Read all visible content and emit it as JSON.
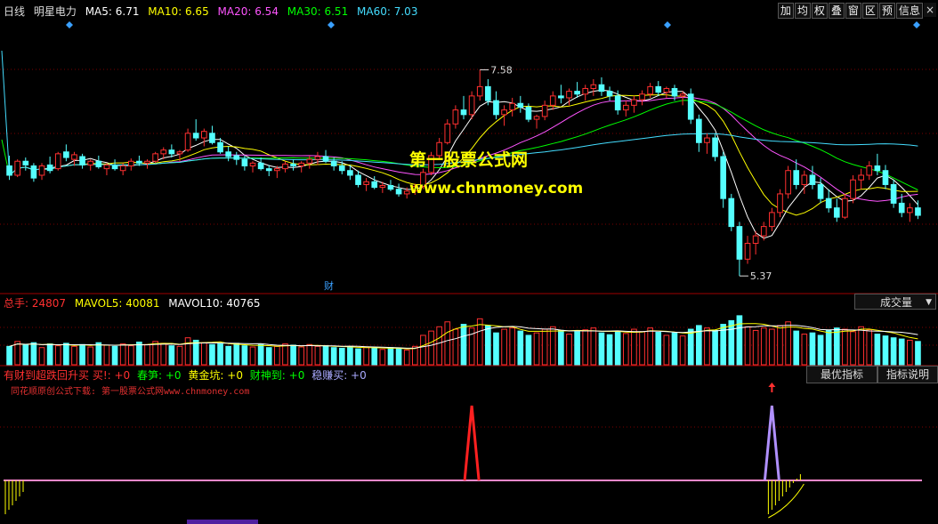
{
  "header": {
    "period": "日线",
    "stock_name": "明星电力",
    "ma": [
      {
        "label": "MA5: 6.71",
        "color": "#ffffff"
      },
      {
        "label": "MA10: 6.65",
        "color": "#ffff00"
      },
      {
        "label": "MA20: 6.54",
        "color": "#ff55ff"
      },
      {
        "label": "MA30: 6.51",
        "color": "#00ff00"
      },
      {
        "label": "MA60: 7.03",
        "color": "#44ddff"
      }
    ]
  },
  "toolbar": [
    "加",
    "均",
    "权",
    "叠",
    "窗",
    "区",
    "预",
    "信息"
  ],
  "toolbar_close": "×",
  "watermark": {
    "line1": "第一股票公式网",
    "line2": "www.chnmoney.com"
  },
  "price_labels": {
    "high": "7.58",
    "low": "5.37",
    "event": "财"
  },
  "volume": {
    "label_total": "总手: 24807",
    "label_mavol5": "MAVOL5: 40081",
    "label_mavol10": "MAVOL10: 40765",
    "dropdown": "成交量",
    "colors": {
      "total": "#ff3030",
      "mavol5": "#ffff00",
      "mavol10": "#ffffff"
    }
  },
  "indicator": {
    "items": [
      {
        "label": "有财到超跌回升买 买!: +0",
        "color": "#ff3030"
      },
      {
        "label": "春笋: +0",
        "color": "#00ff00"
      },
      {
        "label": "黄金坑: +0",
        "color": "#ffff00"
      },
      {
        "label": "财神到: +0",
        "color": "#00ff00"
      },
      {
        "label": "稳赚买: +0",
        "color": "#aaaaff"
      }
    ],
    "subtitle": "同花顺原创公式下载: 第一股票公式网www.chnmoney.com",
    "btn_best": "最优指标",
    "btn_desc": "指标说明"
  },
  "colors": {
    "up": "#ff3030",
    "down": "#55ffff",
    "bg": "#000000",
    "grid": "#a00000"
  },
  "chart_data": {
    "type": "candlestick",
    "price_range": [
      5.2,
      8.1
    ],
    "annotated_high": 7.58,
    "annotated_low": 5.37,
    "ohlc": [
      [
        6.55,
        6.66,
        6.4,
        6.45
      ],
      [
        6.45,
        6.62,
        6.43,
        6.6
      ],
      [
        6.6,
        6.64,
        6.5,
        6.56
      ],
      [
        6.55,
        6.58,
        6.38,
        6.42
      ],
      [
        6.45,
        6.58,
        6.4,
        6.55
      ],
      [
        6.56,
        6.65,
        6.47,
        6.5
      ],
      [
        6.52,
        6.7,
        6.5,
        6.68
      ],
      [
        6.7,
        6.78,
        6.6,
        6.64
      ],
      [
        6.62,
        6.7,
        6.55,
        6.67
      ],
      [
        6.65,
        6.68,
        6.52,
        6.56
      ],
      [
        6.56,
        6.62,
        6.5,
        6.6
      ],
      [
        6.6,
        6.66,
        6.52,
        6.54
      ],
      [
        6.52,
        6.58,
        6.45,
        6.56
      ],
      [
        6.55,
        6.62,
        6.5,
        6.52
      ],
      [
        6.5,
        6.58,
        6.45,
        6.55
      ],
      [
        6.55,
        6.63,
        6.5,
        6.6
      ],
      [
        6.6,
        6.66,
        6.55,
        6.58
      ],
      [
        6.58,
        6.62,
        6.52,
        6.6
      ],
      [
        6.6,
        6.7,
        6.58,
        6.68
      ],
      [
        6.68,
        6.75,
        6.62,
        6.72
      ],
      [
        6.72,
        6.78,
        6.64,
        6.68
      ],
      [
        6.68,
        6.72,
        6.6,
        6.7
      ],
      [
        6.72,
        6.95,
        6.7,
        6.9
      ],
      [
        6.9,
        7.05,
        6.82,
        6.85
      ],
      [
        6.85,
        6.95,
        6.76,
        6.92
      ],
      [
        6.9,
        6.98,
        6.78,
        6.8
      ],
      [
        6.8,
        6.85,
        6.68,
        6.7
      ],
      [
        6.7,
        6.76,
        6.6,
        6.65
      ],
      [
        6.66,
        6.7,
        6.56,
        6.62
      ],
      [
        6.62,
        6.66,
        6.5,
        6.55
      ],
      [
        6.55,
        6.6,
        6.48,
        6.58
      ],
      [
        6.58,
        6.64,
        6.5,
        6.52
      ],
      [
        6.52,
        6.56,
        6.44,
        6.5
      ],
      [
        6.5,
        6.55,
        6.42,
        6.52
      ],
      [
        6.52,
        6.6,
        6.48,
        6.57
      ],
      [
        6.57,
        6.62,
        6.5,
        6.55
      ],
      [
        6.55,
        6.6,
        6.48,
        6.58
      ],
      [
        6.58,
        6.66,
        6.52,
        6.62
      ],
      [
        6.62,
        6.7,
        6.56,
        6.65
      ],
      [
        6.65,
        6.72,
        6.58,
        6.6
      ],
      [
        6.6,
        6.64,
        6.5,
        6.55
      ],
      [
        6.55,
        6.6,
        6.46,
        6.5
      ],
      [
        6.5,
        6.56,
        6.4,
        6.45
      ],
      [
        6.45,
        6.5,
        6.32,
        6.35
      ],
      [
        6.35,
        6.42,
        6.28,
        6.38
      ],
      [
        6.38,
        6.44,
        6.3,
        6.32
      ],
      [
        6.32,
        6.38,
        6.26,
        6.34
      ],
      [
        6.34,
        6.4,
        6.28,
        6.3
      ],
      [
        6.3,
        6.36,
        6.22,
        6.25
      ],
      [
        6.25,
        6.32,
        6.2,
        6.28
      ],
      [
        6.28,
        6.36,
        6.24,
        6.33
      ],
      [
        6.33,
        6.52,
        6.3,
        6.48
      ],
      [
        6.48,
        6.7,
        6.45,
        6.66
      ],
      [
        6.66,
        6.85,
        6.62,
        6.8
      ],
      [
        6.8,
        7.05,
        6.78,
        7.0
      ],
      [
        7.0,
        7.2,
        6.95,
        7.15
      ],
      [
        7.15,
        7.3,
        7.05,
        7.1
      ],
      [
        7.1,
        7.35,
        7.05,
        7.3
      ],
      [
        7.3,
        7.58,
        7.25,
        7.4
      ],
      [
        7.4,
        7.48,
        7.2,
        7.25
      ],
      [
        7.25,
        7.35,
        7.05,
        7.1
      ],
      [
        7.1,
        7.2,
        6.98,
        7.15
      ],
      [
        7.15,
        7.28,
        7.08,
        7.22
      ],
      [
        7.22,
        7.3,
        7.12,
        7.18
      ],
      [
        7.18,
        7.22,
        7.02,
        7.05
      ],
      [
        7.05,
        7.1,
        6.95,
        7.08
      ],
      [
        7.08,
        7.25,
        7.04,
        7.2
      ],
      [
        7.2,
        7.35,
        7.15,
        7.3
      ],
      [
        7.3,
        7.42,
        7.22,
        7.28
      ],
      [
        7.28,
        7.38,
        7.2,
        7.35
      ],
      [
        7.35,
        7.45,
        7.28,
        7.32
      ],
      [
        7.32,
        7.42,
        7.25,
        7.38
      ],
      [
        7.38,
        7.48,
        7.3,
        7.42
      ],
      [
        7.42,
        7.5,
        7.3,
        7.35
      ],
      [
        7.35,
        7.4,
        7.25,
        7.3
      ],
      [
        7.3,
        7.36,
        7.1,
        7.15
      ],
      [
        7.15,
        7.25,
        7.08,
        7.2
      ],
      [
        7.2,
        7.3,
        7.12,
        7.26
      ],
      [
        7.26,
        7.36,
        7.2,
        7.32
      ],
      [
        7.32,
        7.44,
        7.28,
        7.4
      ],
      [
        7.4,
        7.46,
        7.3,
        7.34
      ],
      [
        7.34,
        7.4,
        7.28,
        7.38
      ],
      [
        7.38,
        7.42,
        7.25,
        7.3
      ],
      [
        7.3,
        7.35,
        7.2,
        7.32
      ],
      [
        7.32,
        7.38,
        7.0,
        7.05
      ],
      [
        7.05,
        7.1,
        6.7,
        6.8
      ],
      [
        6.8,
        6.9,
        6.68,
        6.85
      ],
      [
        6.85,
        6.9,
        6.6,
        6.65
      ],
      [
        6.65,
        6.7,
        6.1,
        6.2
      ],
      [
        6.2,
        6.25,
        5.85,
        5.9
      ],
      [
        5.9,
        5.95,
        5.37,
        5.55
      ],
      [
        5.55,
        5.8,
        5.5,
        5.72
      ],
      [
        5.72,
        5.85,
        5.6,
        5.8
      ],
      [
        5.8,
        5.95,
        5.75,
        5.9
      ],
      [
        5.9,
        6.1,
        5.85,
        6.05
      ],
      [
        6.05,
        6.3,
        6.0,
        6.25
      ],
      [
        6.25,
        6.55,
        6.2,
        6.5
      ],
      [
        6.5,
        6.62,
        6.3,
        6.35
      ],
      [
        6.35,
        6.5,
        6.25,
        6.45
      ],
      [
        6.45,
        6.55,
        6.3,
        6.35
      ],
      [
        6.35,
        6.42,
        6.15,
        6.2
      ],
      [
        6.2,
        6.3,
        6.05,
        6.1
      ],
      [
        6.1,
        6.2,
        5.95,
        6.0
      ],
      [
        6.0,
        6.25,
        5.98,
        6.2
      ],
      [
        6.2,
        6.45,
        6.15,
        6.4
      ],
      [
        6.4,
        6.52,
        6.3,
        6.45
      ],
      [
        6.45,
        6.6,
        6.4,
        6.55
      ],
      [
        6.55,
        6.68,
        6.45,
        6.5
      ],
      [
        6.5,
        6.56,
        6.3,
        6.35
      ],
      [
        6.35,
        6.4,
        6.1,
        6.15
      ],
      [
        6.15,
        6.25,
        6.0,
        6.05
      ],
      [
        6.05,
        6.15,
        5.95,
        6.1
      ],
      [
        6.1,
        6.18,
        5.98,
        6.02
      ]
    ],
    "volume": [
      30,
      38,
      32,
      36,
      28,
      34,
      31,
      35,
      30,
      33,
      29,
      36,
      32,
      30,
      34,
      31,
      37,
      33,
      38,
      35,
      31,
      30,
      44,
      40,
      36,
      33,
      34,
      30,
      35,
      31,
      29,
      33,
      28,
      30,
      34,
      32,
      29,
      33,
      30,
      31,
      28,
      27,
      30,
      26,
      29,
      27,
      25,
      28,
      26,
      24,
      30,
      48,
      55,
      62,
      70,
      58,
      66,
      60,
      75,
      64,
      52,
      58,
      60,
      55,
      48,
      52,
      58,
      62,
      56,
      50,
      54,
      57,
      60,
      52,
      49,
      55,
      51,
      58,
      54,
      60,
      53,
      48,
      52,
      47,
      58,
      64,
      60,
      56,
      66,
      72,
      80,
      62,
      56,
      60,
      58,
      64,
      70,
      55,
      50,
      52,
      48,
      56,
      60,
      58,
      54,
      62,
      57,
      50,
      47,
      44,
      42,
      40,
      38
    ],
    "volume_range": [
      0,
      90
    ],
    "indicator_signals": [
      {
        "index": 57,
        "height": 1.0,
        "color": "#ff2020"
      },
      {
        "index": 94,
        "height": 1.0,
        "color": "#b090ff"
      }
    ]
  }
}
